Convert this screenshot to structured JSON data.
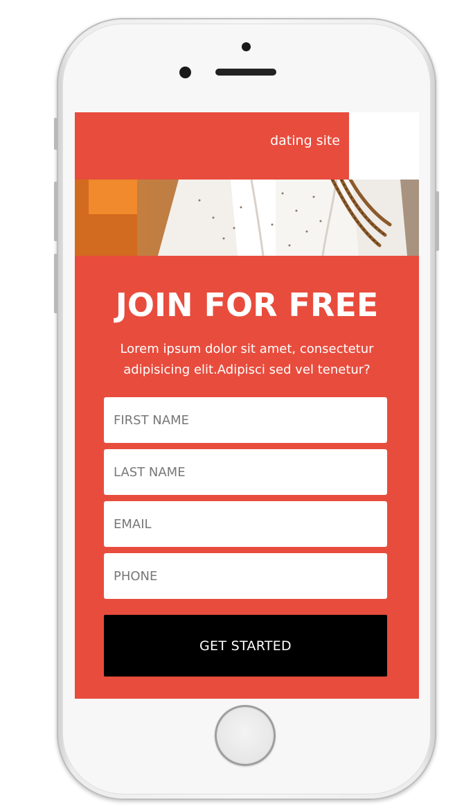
{
  "header": {
    "site_name": "dating site"
  },
  "hero": {
    "image_icon": "photo-icon"
  },
  "signup": {
    "headline": "JOIN FOR FREE",
    "description": "Lorem ipsum dolor sit amet, consectetur adipisicing elit.Adipisci sed vel tenetur?",
    "fields": {
      "first_name_placeholder": "FIRST NAME",
      "last_name_placeholder": "LAST NAME",
      "email_placeholder": "EMAIL",
      "phone_placeholder": "PHONE"
    },
    "cta_label": "GET STARTED"
  },
  "colors": {
    "accent": "#e84c3d",
    "button": "#000000",
    "field_bg": "#ffffff",
    "text_on_accent": "#ffffff"
  }
}
